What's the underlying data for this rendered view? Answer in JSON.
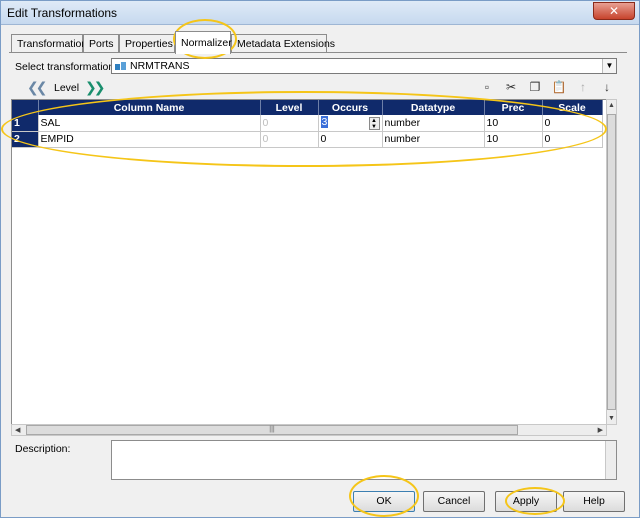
{
  "window": {
    "title": "Edit Transformations",
    "close_label": "✕"
  },
  "tabs": [
    {
      "label": "Transformation",
      "active": false
    },
    {
      "label": "Ports",
      "active": false
    },
    {
      "label": "Properties",
      "active": false
    },
    {
      "label": "Normalizer",
      "active": true
    },
    {
      "label": "Metadata Extensions",
      "active": false
    }
  ],
  "select": {
    "label": "Select transformation:",
    "value": "NRMTRANS"
  },
  "level_nav": {
    "label": "Level"
  },
  "grid": {
    "columns": [
      "Column Name",
      "Level",
      "Occurs",
      "Datatype",
      "Prec",
      "Scale"
    ],
    "rows": [
      {
        "num": "1",
        "name": "SAL",
        "level": "0",
        "occurs": "3",
        "datatype": "number",
        "prec": "10",
        "scale": "0"
      },
      {
        "num": "2",
        "name": "EMPID",
        "level": "0",
        "occurs": "0",
        "datatype": "number",
        "prec": "10",
        "scale": "0"
      }
    ]
  },
  "description": {
    "label": "Description:",
    "value": ""
  },
  "buttons": {
    "ok": "OK",
    "cancel": "Cancel",
    "apply": "Apply",
    "help": "Help"
  },
  "colors": {
    "grid_header": "#102a6b",
    "annotation": "#f5c518"
  }
}
